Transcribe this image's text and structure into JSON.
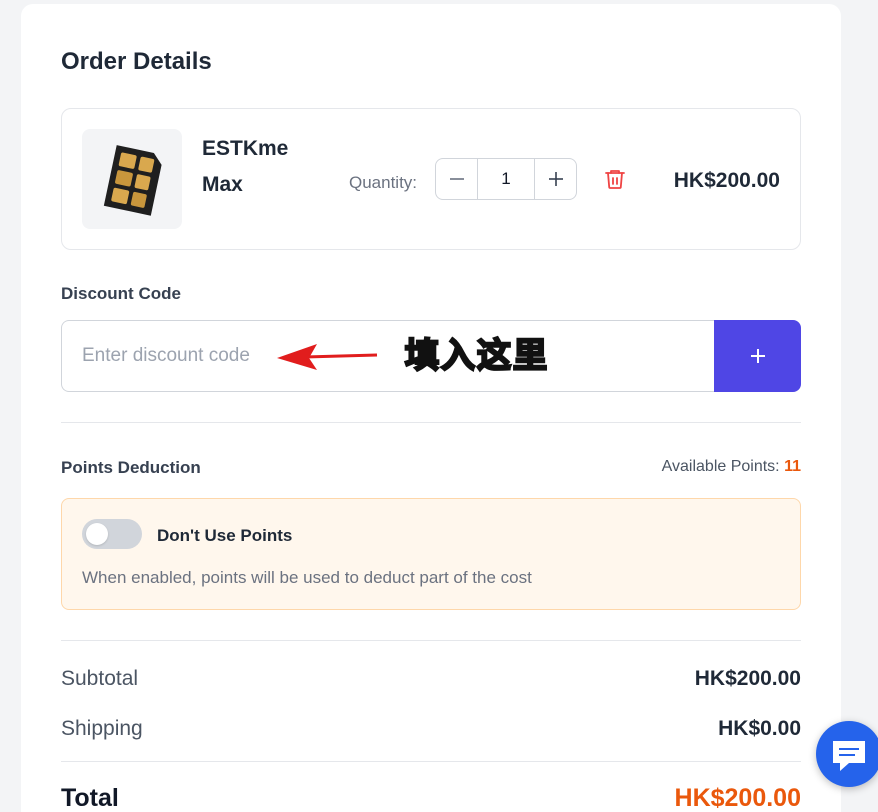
{
  "order": {
    "title": "Order Details"
  },
  "product": {
    "name": "ESTKme Max",
    "quantity_label": "Quantity:",
    "quantity": "1",
    "price": "HK$200.00",
    "image_icon": "sim-card-icon"
  },
  "discount": {
    "label": "Discount Code",
    "placeholder": "Enter discount code",
    "value": "",
    "add_icon": "plus-icon",
    "annotation": "填入这里"
  },
  "points": {
    "label": "Points Deduction",
    "available_label": "Available Points:",
    "available_value": "11",
    "toggle_label": "Don't Use Points",
    "toggle_on": false,
    "description": "When enabled, points will be used to deduct part of the cost"
  },
  "summary": {
    "subtotal_label": "Subtotal",
    "subtotal_value": "HK$200.00",
    "shipping_label": "Shipping",
    "shipping_value": "HK$0.00",
    "total_label": "Total",
    "total_value": "HK$200.00"
  },
  "colors": {
    "accent": "#4f46e5",
    "price_highlight": "#ea580c",
    "delete": "#ef4444",
    "annotation_text": "#fde047",
    "arrow": "#e11d1d",
    "chat": "#2563eb"
  }
}
